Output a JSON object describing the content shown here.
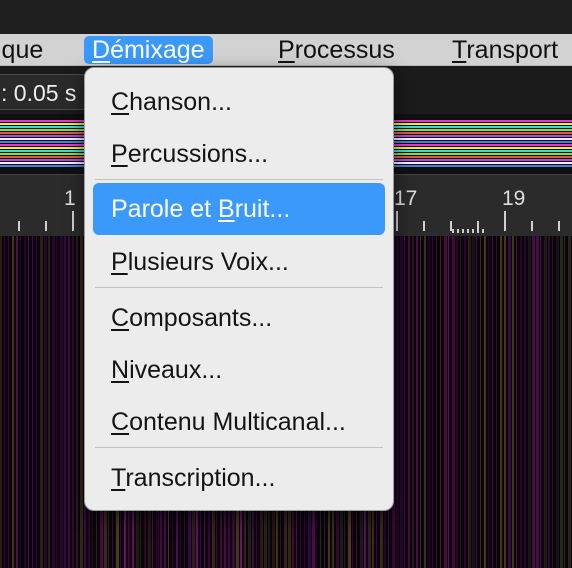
{
  "menubar": {
    "items": [
      {
        "label_pre": "",
        "label_ul": "",
        "label_post": "ique",
        "partial_prefix": "I"
      },
      {
        "label_pre": "",
        "label_ul": "D",
        "label_post": "émixage",
        "active": true
      },
      {
        "label_pre": "",
        "label_ul": "P",
        "label_post": "rocessus"
      },
      {
        "label_pre": "",
        "label_ul": "T",
        "label_post": "ransport"
      }
    ]
  },
  "toolbar": {
    "step_value": ": 0.05 s"
  },
  "ruler": {
    "labels": [
      "1",
      "17",
      "19"
    ]
  },
  "dropdown": {
    "items": [
      {
        "ul": "C",
        "rest": "hanson..."
      },
      {
        "ul": "P",
        "rest": "ercussions..."
      },
      {
        "pre": "Parole et ",
        "ul": "B",
        "rest": "ruit..."
      },
      {
        "ul": "P",
        "rest": "lusieurs Voix..."
      },
      {
        "ul": "C",
        "rest": "omposants..."
      },
      {
        "ul": "N",
        "rest": "iveaux..."
      },
      {
        "ul": "C",
        "rest": "ontenu Multicanal..."
      },
      {
        "ul": "T",
        "rest": "ranscription..."
      }
    ]
  },
  "colors": {
    "accent": "#3b99fc",
    "menu_bg": "#ececec",
    "track_colors": [
      "#e23ad1",
      "#f2e84a",
      "#3ad9e2",
      "#7ce24a",
      "#e2574a",
      "#b04ae2",
      "#f2f2f2",
      "#4a7ce2"
    ]
  }
}
